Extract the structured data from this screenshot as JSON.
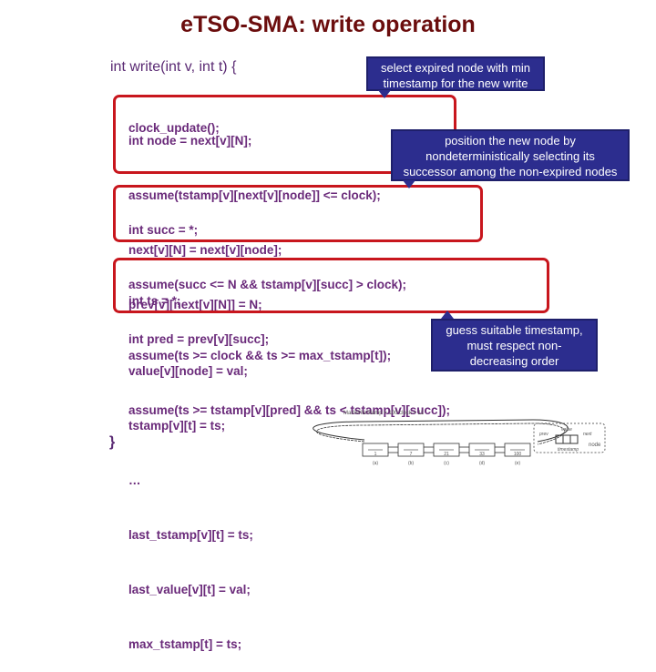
{
  "title": "eTSO-SMA: write operation",
  "code": {
    "signature": "int write(int v, int t) {",
    "preamble": [
      "clock_update();"
    ],
    "block1": [
      "int node = next[v][N];",
      "assume(tstamp[v][next[v][node]] <= clock);",
      "next[v][N] = next[v][node];",
      "prev[v][next[v][N]] = N;"
    ],
    "block2": [
      "int succ = *;",
      "assume(succ <= N && tstamp[v][succ] > clock);",
      "int pred = prev[v][succ];"
    ],
    "block3": [
      "int ts = *;",
      "assume(ts >= clock && ts >= max_tstamp[t]);",
      "assume(ts >= tstamp[v][pred] && ts < tstamp[v][succ]);"
    ],
    "tail": [
      "value[v][node] = val;",
      "tstamp[v][t] = ts;",
      "…",
      "last_tstamp[v][t] = ts;",
      "last_value[v][t] = val;",
      "max_tstamp[t] = ts;"
    ],
    "closing": "}"
  },
  "callouts": {
    "select": [
      "select expired node with min",
      "timestamp for the new write"
    ],
    "position": [
      "position the new node by",
      "nondeterministically selecting its",
      "successor among the non-expired nodes"
    ],
    "guess": [
      "guess suitable timestamp,",
      "must respect non-",
      "decreasing order"
    ]
  },
  "diagram": {
    "header": "MaxWriteStamp = 100     clock = 11",
    "nodes": [
      {
        "value": "1",
        "label": "(a)"
      },
      {
        "value": "7",
        "label": "(b)"
      },
      {
        "value": "21",
        "label": "(c)"
      },
      {
        "value": "33",
        "label": "(d)"
      },
      {
        "value": "100",
        "label": "(e)"
      }
    ],
    "legend": {
      "top": "value",
      "left": "prev",
      "right": "next",
      "bottom": "timestamp",
      "name": "node"
    }
  },
  "colors": {
    "title": "#6b0d0d",
    "code": "#6a2a7a",
    "box_border": "#c8161d",
    "callout_bg": "#2c2d8e"
  }
}
